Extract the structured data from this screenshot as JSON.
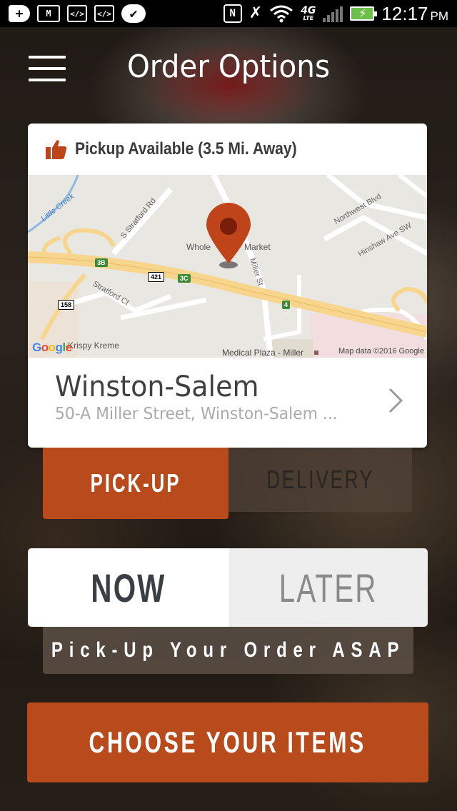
{
  "status_bar": {
    "time": "12:17",
    "ampm": "PM",
    "network": "4G",
    "network_sub": "LTE",
    "icons": [
      "add-icon",
      "gmail-icon",
      "code-icon",
      "code-icon",
      "checkmark-app-icon",
      "nfc-icon",
      "mute-icon",
      "wifi-icon",
      "signal-icon",
      "battery-charging-icon"
    ]
  },
  "header": {
    "title": "Order Options",
    "menu_icon": "hamburger-menu-icon"
  },
  "location_card": {
    "pickup_label": "Pickup Available (3.5 Mi. Away)",
    "pickup_icon": "thumbs-up-icon",
    "city": "Winston-Salem",
    "address": "50-A Miller Street, Winston-Salem ...",
    "map": {
      "labels": {
        "little_creek": "Little Creek",
        "stratford_rd": "S Stratford Rd",
        "stratford_ct": "Stratford Ct",
        "whole_market": "Whole",
        "whole_market_2": "Market",
        "miller_st": "Miller St",
        "northwest_blvd": "Northwest Blvd",
        "hinshaw": "Hinshaw Ave SW",
        "krispy": "Krispy Kreme",
        "medical_plaza": "Medical Plaza - Miller",
        "shield_3b": "3B",
        "shield_421": "421",
        "shield_3c": "3C",
        "shield_158": "158",
        "shield_4": "4"
      },
      "google": "Google",
      "attribution": "Map data ©2016 Google",
      "pin_color": "#c0441a"
    }
  },
  "fulfillment": {
    "pickup_label": "PICK-UP",
    "delivery_label": "DELIVERY",
    "selected": "pickup"
  },
  "timing": {
    "now_label": "NOW",
    "later_label": "LATER",
    "selected": "now",
    "banner": "Pick-Up Your Order ASAP"
  },
  "cta": {
    "label": "CHOOSE YOUR ITEMS"
  },
  "colors": {
    "accent": "#b84a1c",
    "text_dark": "#3a3f44"
  }
}
